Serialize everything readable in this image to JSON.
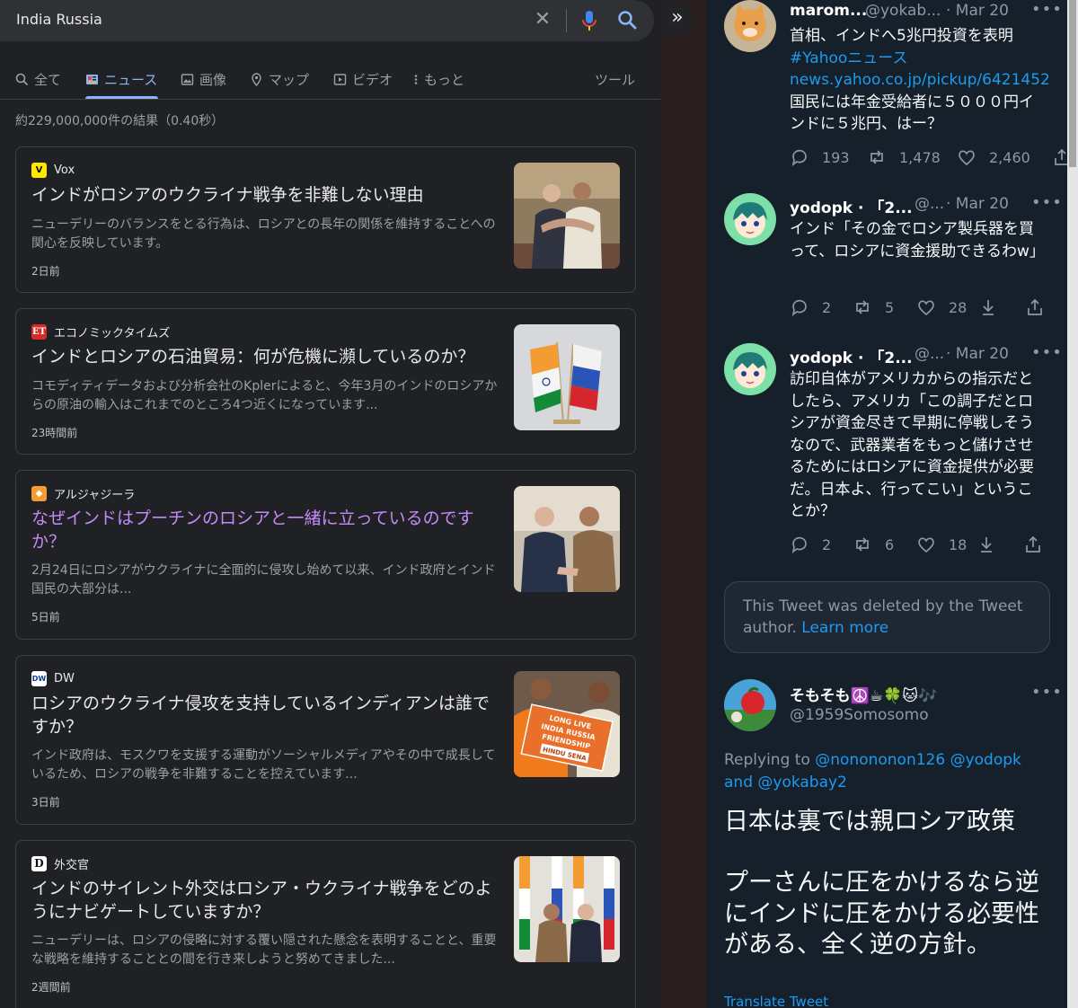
{
  "search": {
    "query": "India Russia",
    "result_count": "約229,000,000件の結果（0.40秒）"
  },
  "tabs": [
    {
      "label": "全て",
      "icon": "search-icon"
    },
    {
      "label": "ニュース",
      "icon": "news-icon",
      "active": true
    },
    {
      "label": "画像",
      "icon": "image-icon"
    },
    {
      "label": "マップ",
      "icon": "map-pin-icon"
    },
    {
      "label": "ビデオ",
      "icon": "video-icon"
    },
    {
      "label": "もっと",
      "icon": "more-vert-icon"
    }
  ],
  "tools_label": "ツール",
  "news": [
    {
      "source": "Vox",
      "title": "インドがロシアのウクライナ戦争を非難しない理由",
      "snippet": "ニューデリーのバランスをとる行為は、ロシアとの長年の関係を維持することへの関心を反映しています。",
      "age": "2日前"
    },
    {
      "source": "エコノミックタイムズ",
      "title": "インドとロシアの石油貿易：何が危機に瀕しているのか？",
      "snippet": "コモディティデータおよび分析会社のKplerによると、今年3月のインドのロシアからの原油の輸入はこれまでのところ4つ近くになっています...",
      "age": "23時間前"
    },
    {
      "source": "アルジャジーラ",
      "title": "なぜインドはプーチンのロシアと一緒に立っているのですか？",
      "snippet": "2月24日にロシアがウクライナに全面的に侵攻し始めて以来、インド政府とインド国民の大部分は...",
      "age": "5日前"
    },
    {
      "source": "DW",
      "title": "ロシアのウクライナ侵攻を支持しているインディアンは誰ですか？",
      "snippet": "インド政府は、モスクワを支援する運動がソーシャルメディアやその中で成長しているため、ロシアの戦争を非難することを控えています...",
      "age": "3日前"
    },
    {
      "source": "外交官",
      "title": "インドのサイレント外交はロシア・ウクライナ戦争をどのようにナビゲートしていますか？",
      "snippet": "ニューデリーは、ロシアの侵略に対する覆い隠された懸念を表明することと、重要な戦略を維持することとの間を行き来しようと努めてきました...",
      "age": "2週間前"
    }
  ],
  "thumb_text": {
    "sign_line1": "LONG LIVE",
    "sign_line2": "INDIA RUSSIA",
    "sign_line3": "FRIENDSHIP",
    "sign_line4": "HINDU SENA",
    "logo_et": "ET",
    "logo_vox": "V",
    "logo_dw": "DW",
    "logo_dip": "D"
  },
  "tweets": [
    {
      "name": "marom...",
      "handle": "@yokab...",
      "date": "· Mar 20",
      "text1": "首相、インドへ5兆円投資を表明",
      "link1": "#Yahooニュース",
      "link2": "news.yahoo.co.jp/pickup/6421452",
      "text2": "国民には年金受給者に５０００円インドに５兆円、はー？",
      "replies": "193",
      "retweets": "1,478",
      "likes": "2,460"
    },
    {
      "name": "yodopk · 「2...",
      "handle": "@...",
      "date": "· Mar 20",
      "text": "インド「その金でロシア製兵器を買って、ロシアに資金援助できるわw」",
      "replies": "2",
      "retweets": "5",
      "likes": "28"
    },
    {
      "name": "yodopk · 「2...",
      "handle": "@...",
      "date": "· Mar 20",
      "text": "訪印自体がアメリカからの指示だとしたら、アメリカ「この調子だとロシアが資金尽きて早期に停戦しそうなので、武器業者をもっと儲けさせるためにはロシアに資金提供が必要だ。日本よ、行ってこい」ということか？",
      "replies": "2",
      "retweets": "6",
      "likes": "18"
    }
  ],
  "deleted_notice": {
    "text": "This Tweet was deleted by the Tweet author.",
    "link": "Learn more"
  },
  "main_tweet": {
    "name": "そもそも☮️☕🍀🐱🎶",
    "handle": "@1959Somosomo",
    "replying_label": "Replying to",
    "replying_to": "@nonononon126 @yodopk and @yokabay2",
    "line1": "日本は裏では親ロシア政策",
    "line2": "プーさんに圧をかけるなら逆にインドに圧をかける必要性がある、全く逆の方針。",
    "translate": "Translate Tweet"
  },
  "colors": {
    "google_bg": "#202124",
    "twitter_bg": "#15202b",
    "link_blue": "#8ab4f8",
    "visited_purple": "#c58af9",
    "twitter_blue": "#1d9bf0"
  }
}
